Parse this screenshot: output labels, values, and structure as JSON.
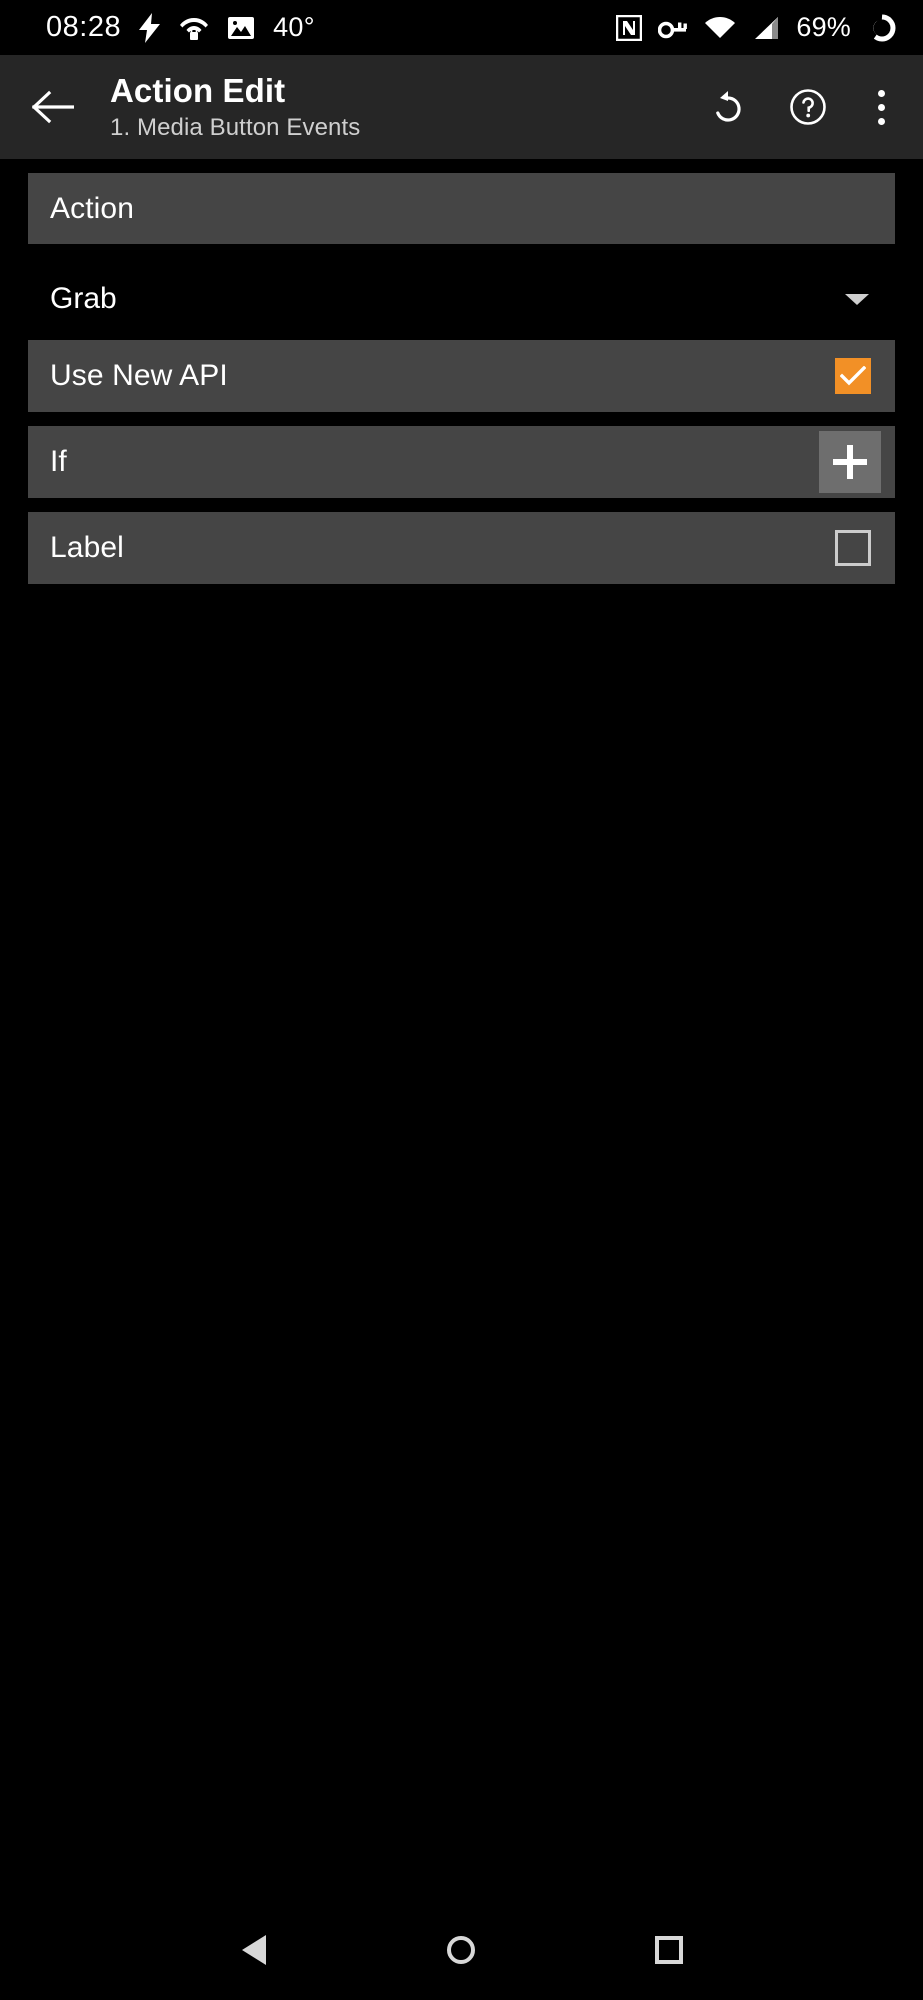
{
  "status_bar": {
    "time": "08:28",
    "temperature": "40°",
    "battery_percent": "69%",
    "left_icons": [
      "charging-bolt-icon",
      "wifi-lock-icon",
      "photo-icon"
    ],
    "right_icons": [
      "nfc-icon",
      "vpn-key-icon",
      "wifi-icon",
      "cellular-signal-icon",
      "battery-circle-icon"
    ]
  },
  "toolbar": {
    "back_icon": "back-arrow-icon",
    "title": "Action Edit",
    "subtitle": "1. Media Button Events",
    "undo_icon": "undo-icon",
    "help_icon": "help-circle-icon",
    "overflow_icon": "overflow-menu-icon"
  },
  "content": {
    "section_action": {
      "header": "Action"
    },
    "action_spinner": {
      "value": "Grab",
      "caret_icon": "chevron-down-icon"
    },
    "rows": [
      {
        "label": "Use New API",
        "control": "checkbox",
        "checked": true
      },
      {
        "label": "If",
        "control": "plus-button",
        "checked": false
      },
      {
        "label": "Label",
        "control": "checkbox",
        "checked": false
      }
    ]
  },
  "nav_bar": {
    "back": "nav-back-icon",
    "home": "nav-home-icon",
    "recents": "nav-recents-icon"
  },
  "colors": {
    "background": "#000000",
    "toolbar": "#262626",
    "row": "#454545",
    "accent": "#f29026",
    "plus_button": "#6e6e6e"
  }
}
